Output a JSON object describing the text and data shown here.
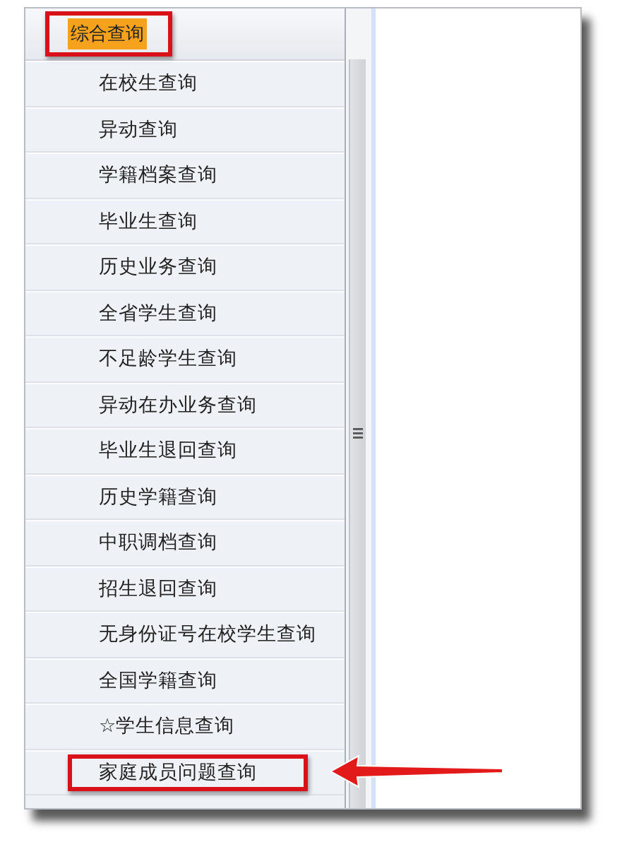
{
  "menu": {
    "group": {
      "label": "综合查询",
      "highlighted": true,
      "annotated": true
    },
    "items": [
      {
        "label": "在校生查询",
        "annotated": false
      },
      {
        "label": "异动查询",
        "annotated": false
      },
      {
        "label": "学籍档案查询",
        "annotated": false
      },
      {
        "label": "毕业生查询",
        "annotated": false
      },
      {
        "label": "历史业务查询",
        "annotated": false
      },
      {
        "label": "全省学生查询",
        "annotated": false
      },
      {
        "label": "不足龄学生查询",
        "annotated": false
      },
      {
        "label": "异动在办业务查询",
        "annotated": false
      },
      {
        "label": "毕业生退回查询",
        "annotated": false
      },
      {
        "label": "历史学籍查询",
        "annotated": false
      },
      {
        "label": "中职调档查询",
        "annotated": false
      },
      {
        "label": "招生退回查询",
        "annotated": false
      },
      {
        "label": "无身份证号在校学生查询",
        "annotated": false
      },
      {
        "label": "全国学籍查询",
        "annotated": false
      },
      {
        "label": "☆学生信息查询",
        "annotated": false
      },
      {
        "label": "家庭成员问题查询",
        "annotated": true
      }
    ]
  }
}
